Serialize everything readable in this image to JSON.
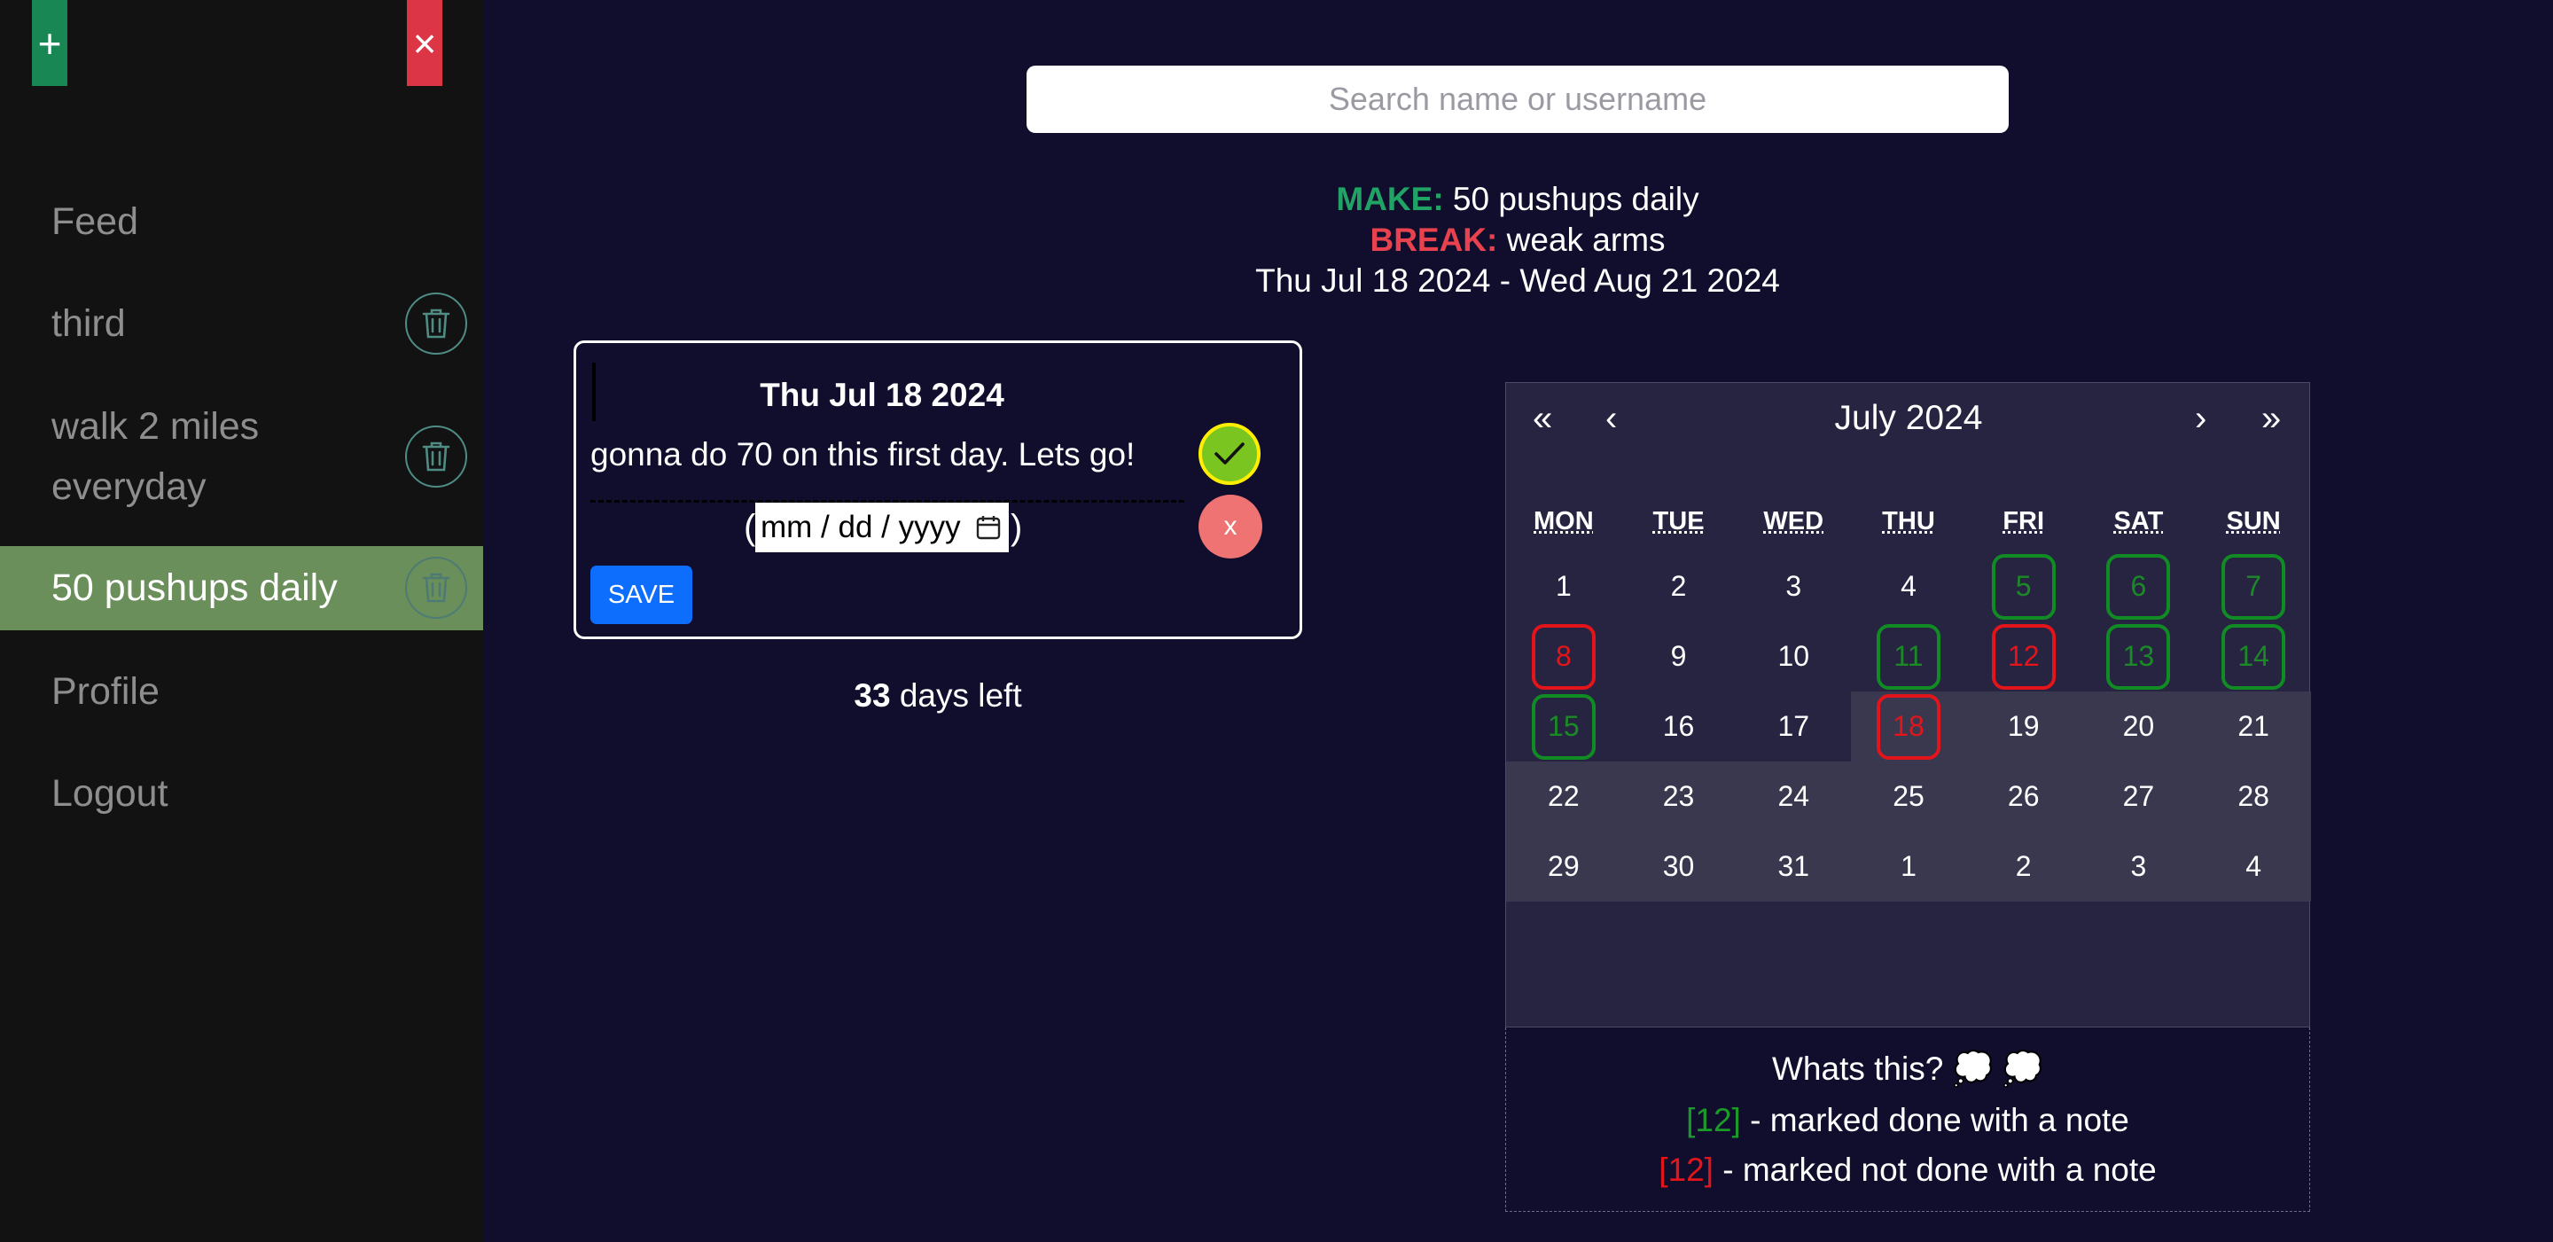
{
  "sidebar": {
    "add_icon": "plus-icon",
    "close_icon": "close-icon",
    "add_symbol": "+",
    "close_symbol": "×",
    "active_color": "#6a8f5b",
    "items": [
      {
        "label": "Feed",
        "deletable": false
      },
      {
        "label": "third",
        "deletable": true
      },
      {
        "label": "walk 2 miles everyday",
        "deletable": true
      },
      {
        "label": "50 pushups daily",
        "deletable": true,
        "active": true
      },
      {
        "label": "Profile",
        "deletable": false
      },
      {
        "label": "Logout",
        "deletable": false
      }
    ]
  },
  "search": {
    "placeholder": "Search name or username",
    "value": ""
  },
  "goal": {
    "make_label": "MAKE:",
    "make_value": "50 pushups daily",
    "break_label": "BREAK:",
    "break_value": "weak arms",
    "date_range": "Thu Jul 18 2024 - Wed Aug 21 2024"
  },
  "note_card": {
    "date": "Thu Jul 18 2024",
    "note": "gonna do 70 on this first day. Lets go!",
    "date_input_placeholder": "mm / dd / yyyy",
    "paren_open": "(",
    "paren_close": ")",
    "save_label": "SAVE",
    "done_icon": "check-icon",
    "not_done_label": "x"
  },
  "days_left": {
    "count": "33",
    "suffix": "days left"
  },
  "calendar": {
    "prev_year": "«",
    "prev_month": "‹",
    "next_month": "›",
    "next_year": "»",
    "month_title": "July 2024",
    "weekdays": [
      "MON",
      "TUE",
      "WED",
      "THU",
      "FRI",
      "SAT",
      "SUN"
    ],
    "weeks": [
      [
        {
          "d": "1"
        },
        {
          "d": "2"
        },
        {
          "d": "3"
        },
        {
          "d": "4"
        },
        {
          "d": "5",
          "mark": "green"
        },
        {
          "d": "6",
          "mark": "green"
        },
        {
          "d": "7",
          "mark": "green"
        }
      ],
      [
        {
          "d": "8",
          "mark": "red"
        },
        {
          "d": "9"
        },
        {
          "d": "10"
        },
        {
          "d": "11",
          "mark": "green"
        },
        {
          "d": "12",
          "mark": "red"
        },
        {
          "d": "13",
          "mark": "green"
        },
        {
          "d": "14",
          "mark": "green"
        }
      ],
      [
        {
          "d": "15",
          "mark": "green"
        },
        {
          "d": "16"
        },
        {
          "d": "17"
        },
        {
          "d": "18",
          "mark": "red"
        },
        {
          "d": "19"
        },
        {
          "d": "20"
        },
        {
          "d": "21"
        }
      ],
      [
        {
          "d": "22"
        },
        {
          "d": "23"
        },
        {
          "d": "24"
        },
        {
          "d": "25"
        },
        {
          "d": "26"
        },
        {
          "d": "27"
        },
        {
          "d": "28"
        }
      ],
      [
        {
          "d": "29"
        },
        {
          "d": "30"
        },
        {
          "d": "31"
        },
        {
          "d": "1"
        },
        {
          "d": "2"
        },
        {
          "d": "3"
        },
        {
          "d": "4"
        }
      ]
    ],
    "range_start": "18",
    "colors": {
      "done": "#118b24",
      "not_done": "#e3151a",
      "range_band": "#3a384f"
    }
  },
  "legend": {
    "title": "Whats this? 💭 💭",
    "green_tag": "[12]",
    "green_text": " - marked done with a note",
    "red_tag": "[12]",
    "red_text": " - marked not done with a note"
  }
}
